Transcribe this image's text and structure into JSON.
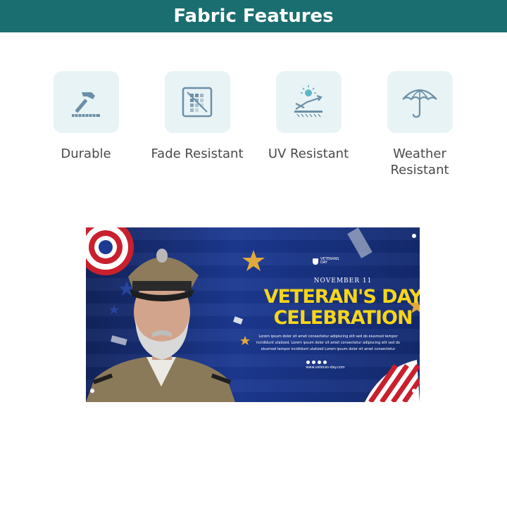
{
  "header": {
    "title": "Fabric Features"
  },
  "features": [
    {
      "label": "Durable",
      "icon": "hammer-icon"
    },
    {
      "label": "Fade Resistant",
      "icon": "fade-icon"
    },
    {
      "label": "UV Resistant",
      "icon": "sun-uv-icon"
    },
    {
      "label": "Weather\nResistant",
      "icon": "umbrella-icon"
    }
  ],
  "banner": {
    "logo_text": "VETERANS\nDAY",
    "date": "NOVEMBER 11",
    "title": "VETERAN'S DAY\nCELEBRATION",
    "body": "Lorem ipsum dolor sit amet consectetur adipiscing elit sed do eiusmod tempor incididunt utalized. Lorem ipsum dolor sit amet consectetur adipiscing elit sed do eiusmod tempor incididunt utalized Lorem ipsum dolor sit amet consectetur",
    "url": "www.veteran-day.com"
  },
  "colors": {
    "header_bg": "#1b6e70",
    "tile_bg": "#e8f3f5",
    "icon_color": "#6b8fa8",
    "icon_accent": "#5fb4c9",
    "title_yellow": "#f7d51a",
    "banner_blue": "#1c3a93"
  }
}
